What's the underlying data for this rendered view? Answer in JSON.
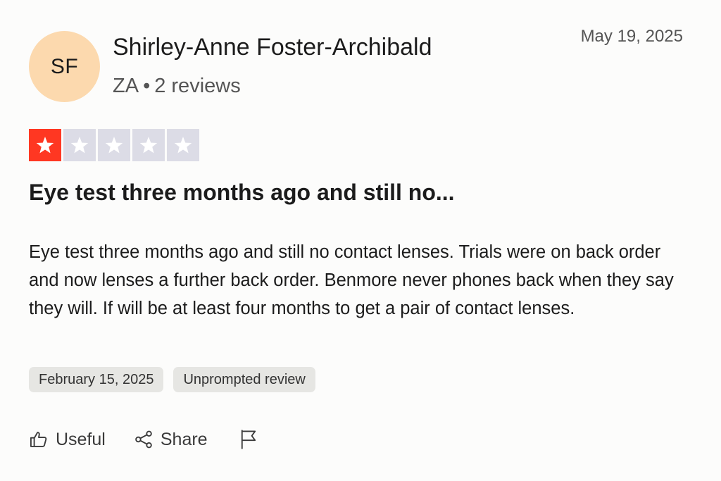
{
  "reviewer": {
    "initials": "SF",
    "name": "Shirley-Anne Foster-Archibald",
    "country": "ZA",
    "separator": "•",
    "review_count": "2 reviews",
    "avatar_color": "#fcd9ae"
  },
  "review": {
    "posted_date": "May 19, 2025",
    "rating": 1,
    "max_rating": 5,
    "star_color_filled": "#ff3722",
    "star_color_empty": "#dcdce6",
    "title": "Eye test three months ago and still no...",
    "body": "Eye test three months ago and still no contact lenses. Trials were on back order and now lenses a further back order. Benmore never phones back when they say they will. If will be at least four months to get a pair of contact lenses.",
    "tags": {
      "experience_date": "February 15, 2025",
      "source": "Unprompted review"
    }
  },
  "actions": {
    "useful_label": "Useful",
    "share_label": "Share",
    "icons": {
      "useful": "thumbs-up-icon",
      "share": "share-icon",
      "report": "flag-icon"
    }
  }
}
